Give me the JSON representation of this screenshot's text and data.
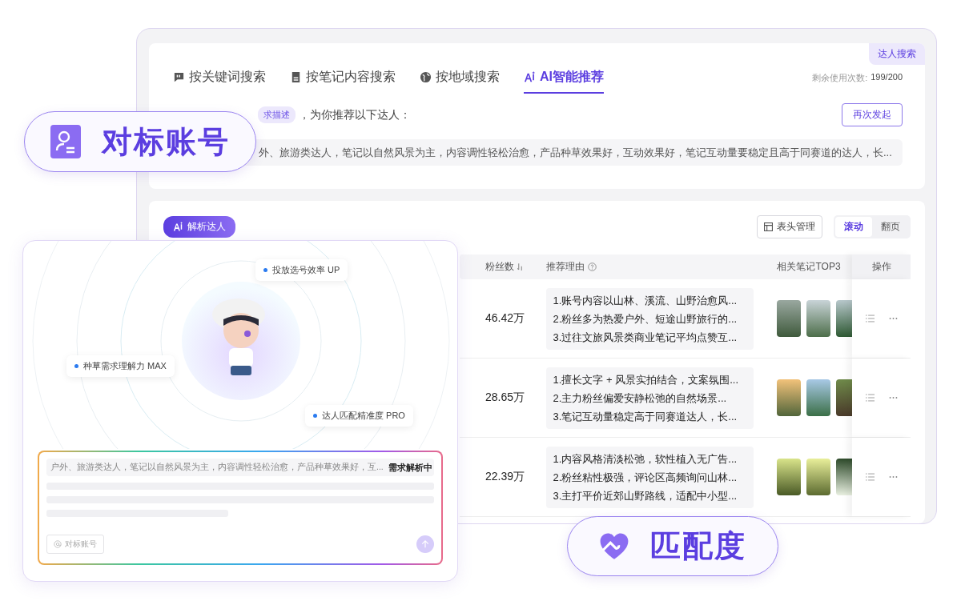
{
  "top_card": {
    "tag": "达人搜索",
    "tabs": [
      {
        "kind": "keyword",
        "label": "按关键词搜索",
        "selected": false
      },
      {
        "kind": "note",
        "label": "按笔记内容搜索",
        "selected": false
      },
      {
        "kind": "region",
        "label": "按地域搜索",
        "selected": false
      },
      {
        "kind": "ai",
        "label": "AI智能推荐",
        "selected": true
      }
    ],
    "quota_label": "剩余使用次数:",
    "quota_value": "199/200",
    "intro_chip": "求描述",
    "intro_text": "，为你推荐以下达人：",
    "retry_button": "再次发起",
    "description": "外、旅游类达人，笔记以自然风景为主，内容调性轻松治愈，产品种草效果好，互动效果好，笔记互动量要稳定且高于同赛道的达人，长..."
  },
  "results": {
    "ai_badge": "解析达人",
    "header_manage": "表头管理",
    "view_modes": [
      {
        "label": "滚动",
        "selected": true
      },
      {
        "label": "翻页",
        "selected": false
      }
    ],
    "columns": [
      {
        "kind": "followers",
        "label": "粉丝数",
        "sortable": true,
        "help": false
      },
      {
        "kind": "reason",
        "label": "推荐理由",
        "sortable": false,
        "help": true
      },
      {
        "kind": "notes",
        "label": "相关笔记TOP3",
        "sortable": false,
        "help": false
      },
      {
        "kind": "actions",
        "label": "操作",
        "sortable": false,
        "help": false
      }
    ],
    "rows": [
      {
        "followers": "46.42万",
        "reasons": [
          "1.账号内容以山林、溪流、山野治愈风...",
          "2.粉丝多为热爱户外、短途山野旅行的...",
          "3.过往文旅风景类商业笔记平均点赞互..."
        ]
      },
      {
        "followers": "28.65万",
        "reasons": [
          "1.擅长文字 + 风景实拍结合，文案氛围...",
          "2.主力粉丝偏爱安静松弛的自然场景...",
          "3.笔记互动量稳定高于同赛道达人，长..."
        ]
      },
      {
        "followers": "22.39万",
        "reasons": [
          "1.内容风格清淡松弛，软性植入无广告...",
          "2.粉丝粘性极强，评论区高频询问山林...",
          "3.主打平价近郊山野路线，适配中小型..."
        ]
      }
    ]
  },
  "analysis_card": {
    "tags": [
      "投放选号效率 UP",
      "种草需求理解力 MAX",
      "达人匹配精准度 PRO"
    ],
    "query": "户外、旅游类达人，笔记以自然风景为主，内容调性轻松治愈，产品种草效果好，互...",
    "status": "需求解析中",
    "mention_chip": "对标账号"
  },
  "callouts": [
    {
      "kind": "account",
      "label": "对标账号"
    },
    {
      "kind": "match",
      "label": "匹配度"
    }
  ]
}
